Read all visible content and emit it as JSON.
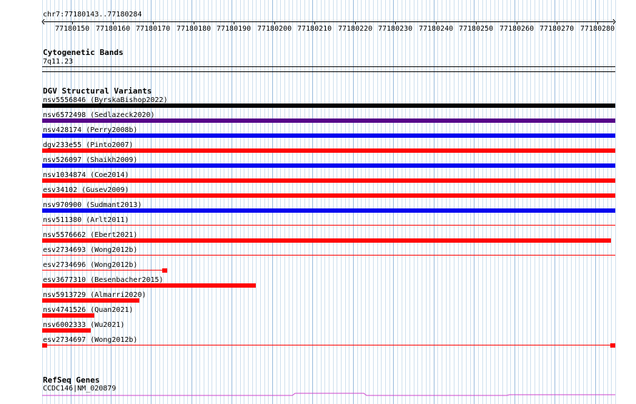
{
  "ruler": {
    "coord_label": "chr7:77180143..77180284",
    "ticks": [
      "77180150",
      "77180160",
      "77180170",
      "77180180",
      "77180190",
      "77180200",
      "77180210",
      "77180220",
      "77180230",
      "77180240",
      "77180250",
      "77180260",
      "77180270",
      "77180280"
    ]
  },
  "cyto": {
    "title": "Cytogenetic Bands",
    "band": "7q11.23"
  },
  "dgv": {
    "title": "DGV Structural Variants",
    "variants": [
      {
        "label": "nsv5556846 (ByrskaBishop2022)",
        "color": "#000000",
        "start": 77180143,
        "end": 77180284
      },
      {
        "label": "nsv6572498 (Sedlazeck2020)",
        "color": "#550088",
        "start": 77180143,
        "end": 77180284
      },
      {
        "label": "nsv428174 (Perry2008b)",
        "color": "#0000ee",
        "start": 77180143,
        "end": 77180284
      },
      {
        "label": "dgv233e55 (Pinto2007)",
        "color": "#ff0000",
        "start": 77180143,
        "end": 77180284
      },
      {
        "label": "nsv526097 (Shaikh2009)",
        "color": "#0000ee",
        "start": 77180143,
        "end": 77180284
      },
      {
        "label": "nsv1034874 (Coe2014)",
        "color": "#ff0000",
        "start": 77180143,
        "end": 77180284
      },
      {
        "label": "esv34102 (Gusev2009)",
        "color": "#ff0000",
        "start": 77180143,
        "end": 77180284
      },
      {
        "label": "nsv970900 (Sudmant2013)",
        "color": "#0000ee",
        "start": 77180143,
        "end": 77180284
      },
      {
        "label": "nsv511380 (Arlt2011)",
        "color": "#ff0000",
        "start": 77180143,
        "end": 77180284,
        "thin": true
      },
      {
        "label": "nsv5576662 (Ebert2021)",
        "color": "#ff0000",
        "start": 77180143,
        "end": 77180283
      },
      {
        "label": "esv2734693 (Wong2012b)",
        "color": "#ff0000",
        "start": 77180143,
        "end": 77180284,
        "thin": true
      },
      {
        "label": "esv2734696 (Wong2012b)",
        "color": "#ff0000",
        "start": 77180143,
        "end": 77180173,
        "thin": true,
        "end_block": true
      },
      {
        "label": "esv3677310 (Besenbacher2015)",
        "color": "#ff0000",
        "start": 77180143,
        "end": 77180195
      },
      {
        "label": "nsv5913729 (Almarri2020)",
        "color": "#ff0000",
        "start": 77180143,
        "end": 77180166
      },
      {
        "label": "nsv4741526 (Quan2021)",
        "color": "#ff0000",
        "start": 77180143,
        "end": 77180155
      },
      {
        "label": "nsv6002333 (Wu2021)",
        "color": "#ff0000",
        "start": 77180143,
        "end": 77180154
      },
      {
        "label": "esv2734697 (Wong2012b)",
        "color": "#ff0000",
        "start": 77180143,
        "end": 77180284,
        "thin": true,
        "start_block": true,
        "end_block": true
      }
    ]
  },
  "refseq": {
    "title": "RefSeq Genes",
    "gene": "CCDC146|NM_020879",
    "color": "#cc44cc"
  }
}
